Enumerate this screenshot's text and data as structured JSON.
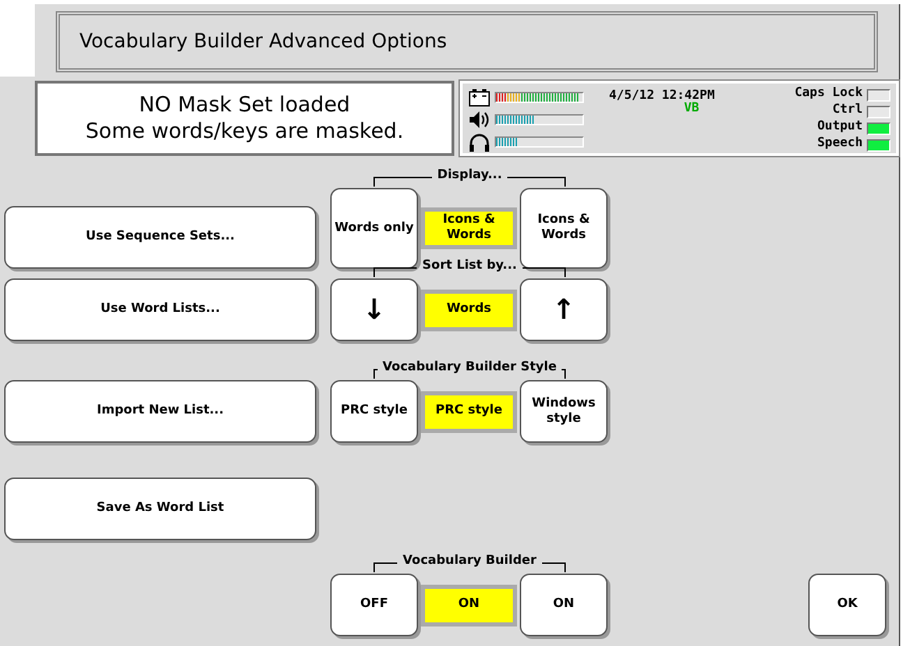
{
  "title": "Vocabulary Builder Advanced Options",
  "message": [
    "NO Mask Set loaded",
    "Some words/keys are masked."
  ],
  "status": {
    "meters": [
      {
        "kind": "battery",
        "level": 0.97
      },
      {
        "kind": "speaker",
        "level": 0.45
      },
      {
        "kind": "headphones",
        "level": 0.25
      }
    ],
    "datetime": "4/5/12 12:42PM",
    "mode": "VB",
    "indicators": [
      {
        "label": "Caps Lock",
        "on": false
      },
      {
        "label": "Ctrl",
        "on": false
      },
      {
        "label": "Output",
        "on": true
      },
      {
        "label": "Speech",
        "on": true
      }
    ]
  },
  "rows": [
    {
      "action": "Use Sequence Sets...",
      "group": {
        "title": "Display...",
        "left": "Words only",
        "current": "Icons & Words",
        "right": "Icons & Words"
      }
    },
    {
      "action": "Use Word Lists...",
      "group": {
        "title": "Sort List by...",
        "left": "↓",
        "current": "Words",
        "right": "↑"
      }
    },
    {
      "action": "Import New List...",
      "group": {
        "title": "Vocabulary Builder Style",
        "left": "PRC style",
        "current": "PRC style",
        "right": "Windows style"
      }
    },
    {
      "action": "Save As Word List"
    },
    {
      "group": {
        "title": "Vocabulary Builder",
        "left": "OFF",
        "current": "ON",
        "right": "ON"
      }
    }
  ],
  "ok_button": "OK"
}
